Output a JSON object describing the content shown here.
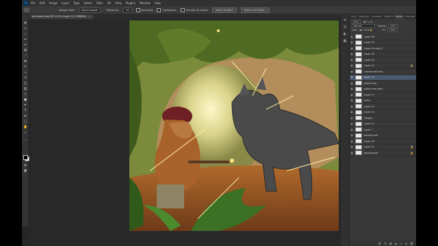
{
  "app": {
    "menu_items": [
      "File",
      "Edit",
      "Image",
      "Layer",
      "Type",
      "Select",
      "Filter",
      "3D",
      "View",
      "Plugins",
      "Window",
      "Help"
    ],
    "logo": "Ps"
  },
  "options": {
    "sample_label": "Sample Size:",
    "sample_value": "Point Sample",
    "tolerance_label": "Tolerance:",
    "tolerance_value": "32",
    "antialias_label": "Anti-alias",
    "contiguous_label": "Contiguous",
    "sample_all_label": "Sample All Layers",
    "select_subject_label": "Select Subject",
    "select_mask_label": "Select and Mask..."
  },
  "document": {
    "tab_title": "pre-bisect.psd @ 12.5% (Layer 12, RGB/8#)",
    "close_glyph": "×"
  },
  "panels": {
    "tabs": [
      "Color",
      "Swatches",
      "Gradients",
      "Patterns",
      "Layers",
      "Channels",
      "Paths",
      "Properties"
    ],
    "active_tab": "Layers",
    "kind_label": "Kind",
    "blend_mode": "Normal",
    "opacity_label": "Opacity:",
    "opacity_value": "100%",
    "lock_label": "Lock:",
    "fill_label": "Fill:",
    "fill_value": "100%"
  },
  "layers": [
    {
      "name": "Layer 26",
      "selected": false,
      "locked": false
    },
    {
      "name": "Layer 25",
      "selected": false,
      "locked": false
    },
    {
      "name": "Layer 24 copy 3",
      "selected": false,
      "locked": false
    },
    {
      "name": "Layer 18",
      "selected": false,
      "locked": false
    },
    {
      "name": "Layer 20",
      "selected": false,
      "locked": false
    },
    {
      "name": "Layer 15",
      "selected": false,
      "locked": true
    },
    {
      "name": "commando man",
      "selected": false,
      "locked": false
    },
    {
      "name": "Layer 12",
      "selected": true,
      "locked": false
    },
    {
      "name": "plants fore",
      "selected": false,
      "locked": false
    },
    {
      "name": "plants fore copy",
      "selected": false,
      "locked": false
    },
    {
      "name": "Layer 17",
      "selected": false,
      "locked": false
    },
    {
      "name": "rhino",
      "selected": false,
      "locked": false
    },
    {
      "name": "Layer 14",
      "selected": false,
      "locked": false
    },
    {
      "name": "Layer 10",
      "selected": false,
      "locked": false
    },
    {
      "name": "Dragon",
      "selected": false,
      "locked": false
    },
    {
      "name": "Layer 11",
      "selected": false,
      "locked": false
    },
    {
      "name": "Layer 7",
      "selected": false,
      "locked": false
    },
    {
      "name": "background",
      "selected": false,
      "locked": false
    },
    {
      "name": "Layer 16",
      "selected": false,
      "locked": false
    },
    {
      "name": "Layer 21",
      "selected": false,
      "locked": true
    },
    {
      "name": "Background",
      "selected": false,
      "locked": true
    }
  ],
  "colors": {
    "accent": "#4a5a6e",
    "foreground": "#000000",
    "background": "#ffffff"
  }
}
